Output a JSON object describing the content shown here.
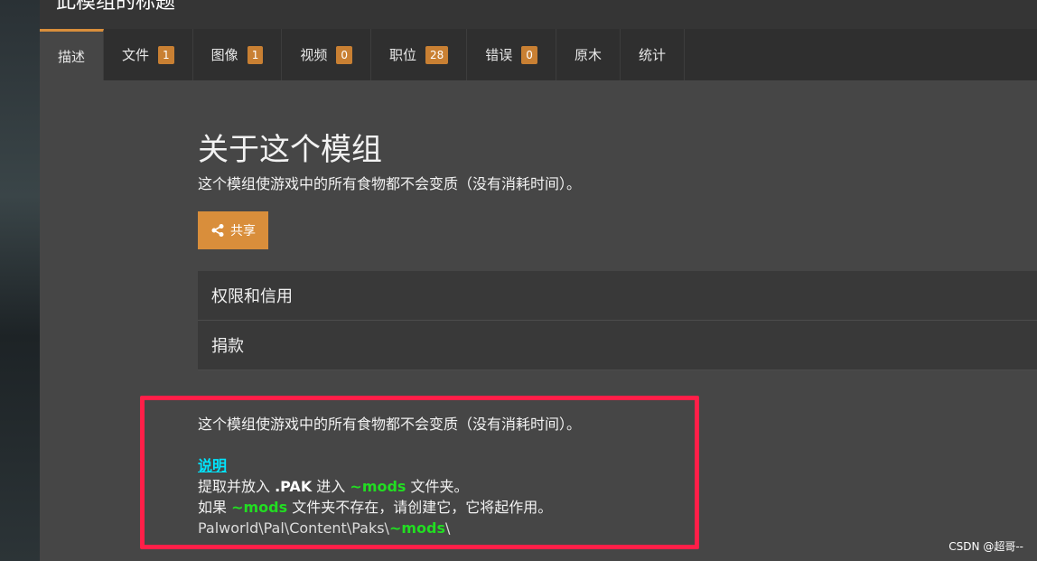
{
  "title_bar": {
    "text": "此模组的标题"
  },
  "tabs": [
    {
      "label": "描述",
      "badge": null,
      "active": true
    },
    {
      "label": "文件",
      "badge": "1"
    },
    {
      "label": "图像",
      "badge": "1"
    },
    {
      "label": "视频",
      "badge": "0"
    },
    {
      "label": "职位",
      "badge": "28"
    },
    {
      "label": "错误",
      "badge": "0"
    },
    {
      "label": "原木",
      "badge": null
    },
    {
      "label": "统计",
      "badge": null
    }
  ],
  "about": {
    "heading": "关于这个模组",
    "summary": "这个模组使游戏中的所有食物都不会变质（没有消耗时间）。",
    "share_label": "共享"
  },
  "accordion": [
    {
      "label": "权限和信用"
    },
    {
      "label": "捐款"
    }
  ],
  "description": {
    "intro": "这个模组使游戏中的所有食物都不会变质（没有消耗时间）。",
    "instructions_heading": "说明",
    "line1_a": "提取并放入 ",
    "line1_pak": ".PAK",
    "line1_b": " 进入 ",
    "line1_mods": "~mods",
    "line1_c": " 文件夹。",
    "line2_a": "如果 ",
    "line2_mods": "~mods",
    "line2_b": " 文件夹不存在，请创建它，它将起作用。",
    "path_prefix": "Palworld\\Pal\\Content\\Paks\\",
    "path_mods": "~mods",
    "path_suffix": "\\"
  },
  "watermark": "CSDN @超哥--",
  "colors": {
    "accent": "#d98e3b",
    "highlight_border": "#ff1f48",
    "link": "#00e5ff",
    "green": "#22dd22"
  }
}
